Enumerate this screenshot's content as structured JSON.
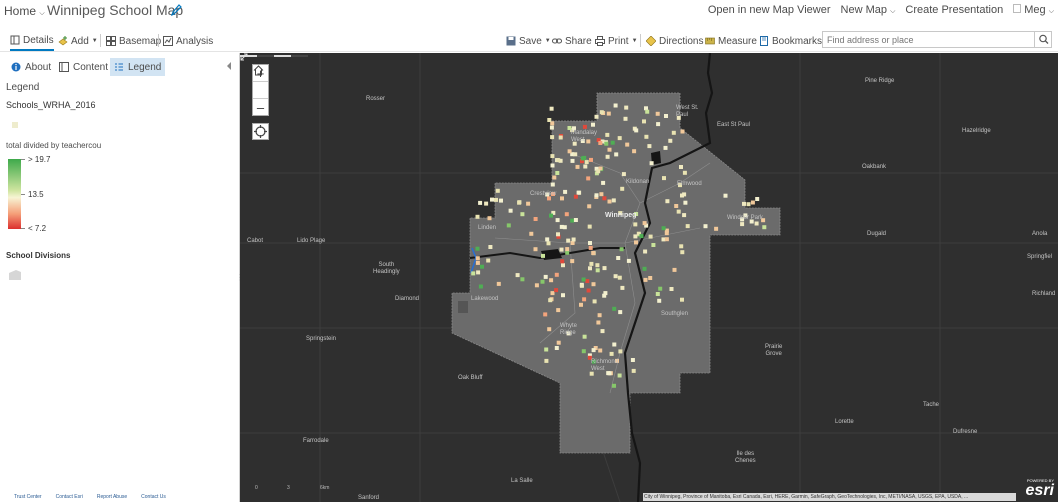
{
  "header": {
    "home_label": "Home",
    "map_title": "Winnipeg School Map",
    "open_in_viewer": "Open in new Map Viewer",
    "new_map": "New Map",
    "create_presentation": "Create Presentation",
    "user": "Meg"
  },
  "toolbar": {
    "details": "Details",
    "add": "Add",
    "basemap": "Basemap",
    "analysis": "Analysis",
    "save": "Save",
    "share": "Share",
    "print": "Print",
    "directions": "Directions",
    "measure": "Measure",
    "bookmarks": "Bookmarks",
    "search_placeholder": "Find address or place"
  },
  "panel": {
    "tabs": {
      "about": "About",
      "content": "Content",
      "legend": "Legend"
    },
    "legend_heading": "Legend",
    "layer_name": "Schools_WRHA_2016",
    "field_label": "total divided by teachercou",
    "ramp": {
      "high": "> 19.7",
      "mid": "13.5",
      "low": "< 7.2"
    },
    "divisions_name": "School Divisions",
    "footer": {
      "trust_center": "Trust Center",
      "contact_esri": "Contact Esri",
      "report_abuse": "Report Abuse",
      "contact_us": "Contact Us"
    }
  },
  "map": {
    "places": {
      "rosser": "Rosser",
      "west_st_paul": "West St.\nPaul",
      "east_st_paul": "East St Paul",
      "pine_ridge": "Pine Ridge",
      "hazelridge": "Hazelridge",
      "oakbank": "Oakbank",
      "mandalay_west": "Mandalay\nWest",
      "winnipeg": "Winnipeg",
      "elmwood": "Elmwood",
      "cabot": "Cabot",
      "lido_plage": "Lido Plage",
      "dugald": "Dugald",
      "anola": "Anola",
      "springfield": "Springfiel",
      "richland": "Richland",
      "south_headingly": "South\nHeadingly",
      "diamond": "Diamond",
      "lakewood": "Lakewood",
      "springstein": "Springstein",
      "whyte_ridge": "Whyte\nRidge",
      "southglen": "Southglen",
      "prairie_grove": "Prairie\nGrove",
      "oak_bluff": "Oak Bluff",
      "richmond_west": "Richmond\nWest",
      "tache": "Tache",
      "lorette": "Lorette",
      "dufresne": "Dufresne",
      "farrodale": "Farrodale",
      "ile_des_chenes": "Ile des\nChenes",
      "la_salle": "La Salle",
      "sanford": "Sanford",
      "crestview": "Crestview",
      "windsor_park": "Windsor Park",
      "linden": "Linden",
      "kildonan": "Kildonan"
    },
    "scale": {
      "zero": "0",
      "mid": "3",
      "end": "6km"
    },
    "attribution": "City of Winnipeg, Province of Manitoba, Esri Canada, Esri, HERE, Garmin, SafeGraph, GeoTechnologies, Inc, METI/NASA, USGS, EPA, USDA, ...",
    "esri_powered": "POWERED BY",
    "esri_logo": "esri"
  },
  "colors": {
    "accent": "#0079c1",
    "ramp_high": "#3ea94b",
    "ramp_mid": "#f7f4d4",
    "ramp_low": "#dc2f2e",
    "map_background": "#2f2f2f",
    "city_fill": "#6b6b6b"
  },
  "icons": {
    "home": "chevron-down-icon",
    "edit": "pencil-icon",
    "details": "details-icon",
    "add": "add-layer-icon",
    "basemap": "basemap-grid-icon",
    "analysis": "analysis-icon",
    "save": "floppy-icon",
    "share": "link-icon",
    "print": "printer-icon",
    "directions": "directions-icon",
    "measure": "ruler-icon",
    "bookmarks": "bookmark-icon",
    "search": "search-icon",
    "about": "info-icon",
    "content": "content-icon",
    "legend": "legend-icon",
    "zoom_in": "plus-icon",
    "zoom_out": "minus-icon",
    "home_extent": "home-icon",
    "locate": "locate-icon",
    "fullscreen": "expand-icon"
  }
}
